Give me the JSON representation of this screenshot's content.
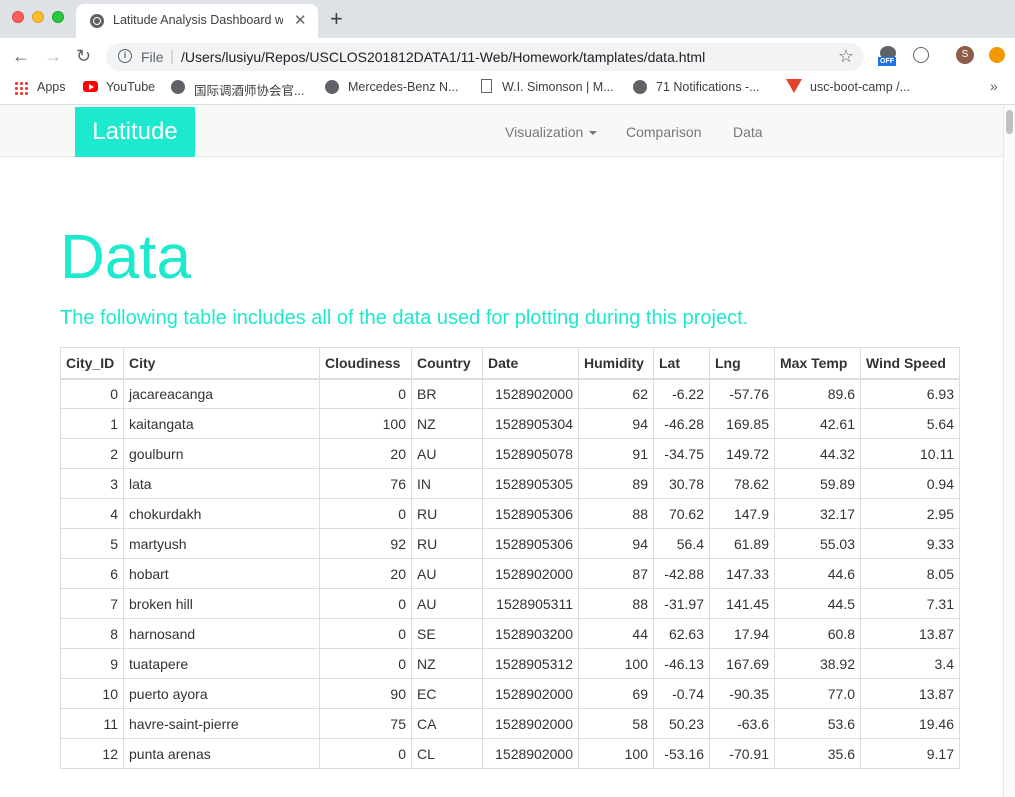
{
  "browser": {
    "tab_title": "Latitude Analysis Dashboard w",
    "file_label": "File",
    "url": "/Users/lusiyu/Repos/USCLOS201812DATA1/11-Web/Homework/tamplates/data.html",
    "ext_badge": "OFF",
    "avatar_letter": "S",
    "bookmarks": [
      "Apps",
      "YouTube",
      "国际调酒师协会官...",
      "Mercedes-Benz N...",
      "W.I. Simonson | M...",
      "71 Notifications -...",
      "usc-boot-camp /..."
    ]
  },
  "navbar": {
    "brand": "Latitude",
    "links": [
      "Visualization",
      "Comparison",
      "Data"
    ]
  },
  "page": {
    "title": "Data",
    "lead": "The following table includes all of the data used for plotting during this project."
  },
  "table": {
    "headers": [
      "City_ID",
      "City",
      "Cloudiness",
      "Country",
      "Date",
      "Humidity",
      "Lat",
      "Lng",
      "Max Temp",
      "Wind Speed"
    ],
    "rows": [
      [
        "0",
        "jacareacanga",
        "0",
        "BR",
        "1528902000",
        "62",
        "-6.22",
        "-57.76",
        "89.6",
        "6.93"
      ],
      [
        "1",
        "kaitangata",
        "100",
        "NZ",
        "1528905304",
        "94",
        "-46.28",
        "169.85",
        "42.61",
        "5.64"
      ],
      [
        "2",
        "goulburn",
        "20",
        "AU",
        "1528905078",
        "91",
        "-34.75",
        "149.72",
        "44.32",
        "10.11"
      ],
      [
        "3",
        "lata",
        "76",
        "IN",
        "1528905305",
        "89",
        "30.78",
        "78.62",
        "59.89",
        "0.94"
      ],
      [
        "4",
        "chokurdakh",
        "0",
        "RU",
        "1528905306",
        "88",
        "70.62",
        "147.9",
        "32.17",
        "2.95"
      ],
      [
        "5",
        "martyush",
        "92",
        "RU",
        "1528905306",
        "94",
        "56.4",
        "61.89",
        "55.03",
        "9.33"
      ],
      [
        "6",
        "hobart",
        "20",
        "AU",
        "1528902000",
        "87",
        "-42.88",
        "147.33",
        "44.6",
        "8.05"
      ],
      [
        "7",
        "broken hill",
        "0",
        "AU",
        "1528905311",
        "88",
        "-31.97",
        "141.45",
        "44.5",
        "7.31"
      ],
      [
        "8",
        "harnosand",
        "0",
        "SE",
        "1528903200",
        "44",
        "62.63",
        "17.94",
        "60.8",
        "13.87"
      ],
      [
        "9",
        "tuatapere",
        "0",
        "NZ",
        "1528905312",
        "100",
        "-46.13",
        "167.69",
        "38.92",
        "3.4"
      ],
      [
        "10",
        "puerto ayora",
        "90",
        "EC",
        "1528902000",
        "69",
        "-0.74",
        "-90.35",
        "77.0",
        "13.87"
      ],
      [
        "11",
        "havre-saint-pierre",
        "75",
        "CA",
        "1528902000",
        "58",
        "50.23",
        "-63.6",
        "53.6",
        "19.46"
      ],
      [
        "12",
        "punta arenas",
        "0",
        "CL",
        "1528902000",
        "100",
        "-53.16",
        "-70.91",
        "35.6",
        "9.17"
      ]
    ]
  }
}
